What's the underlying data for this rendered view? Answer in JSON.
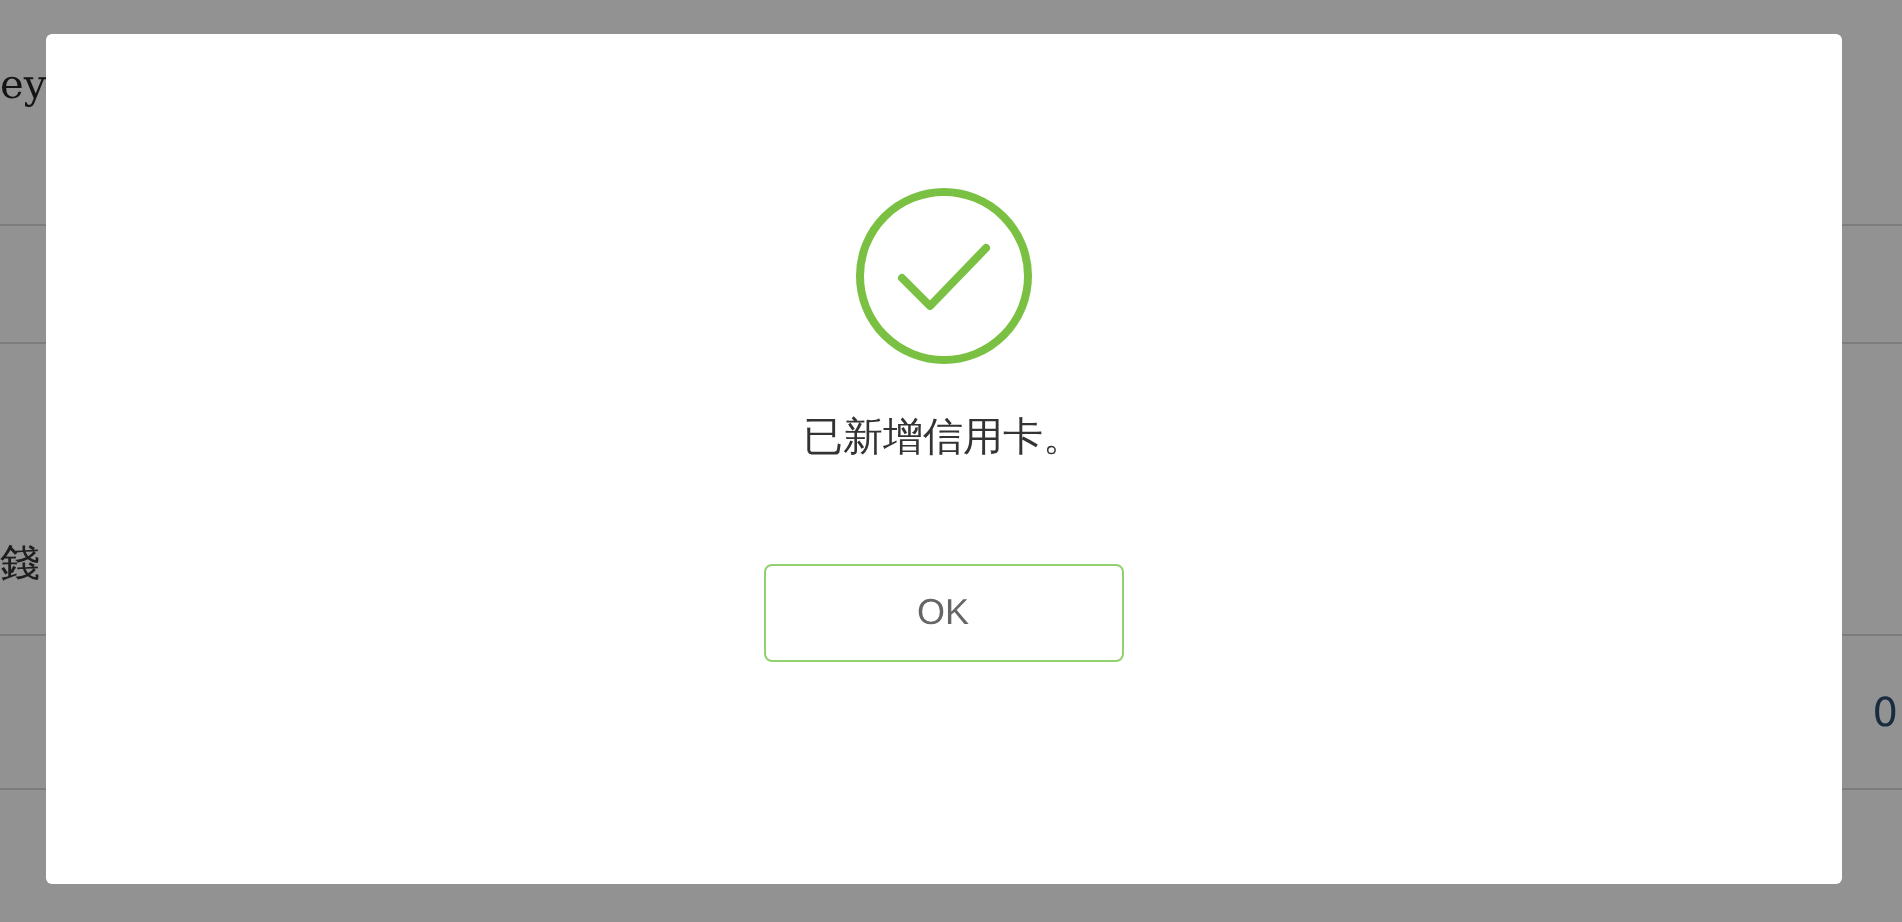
{
  "background": {
    "header_text": "ey",
    "section_text": "錢",
    "cell_text": "0"
  },
  "dialog": {
    "kind": "success",
    "message": "已新增信用卡。",
    "buttons": [
      "OK"
    ]
  }
}
